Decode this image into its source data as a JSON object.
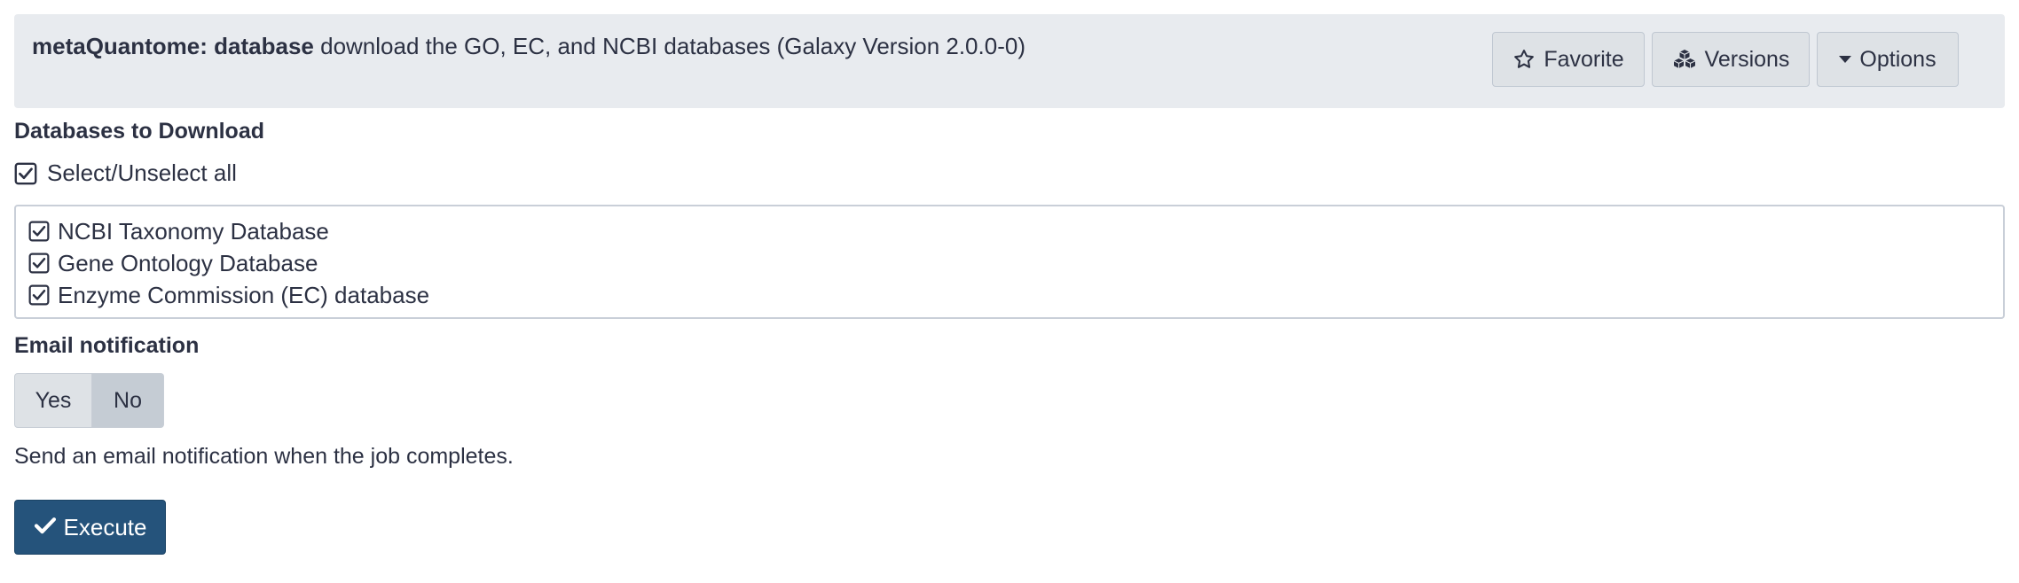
{
  "header": {
    "tool_name": "metaQuantome: database",
    "description": "download the GO, EC, and NCBI databases (Galaxy Version 2.0.0-0)",
    "favorite_label": "Favorite",
    "versions_label": "Versions",
    "options_label": "Options"
  },
  "databases": {
    "label": "Databases to Download",
    "select_all_label": "Select/Unselect all",
    "select_all_checked": true,
    "options": [
      {
        "label": "NCBI Taxonomy Database",
        "checked": true
      },
      {
        "label": "Gene Ontology Database",
        "checked": true
      },
      {
        "label": "Enzyme Commission (EC) database",
        "checked": true
      }
    ]
  },
  "email": {
    "label": "Email notification",
    "yes_label": "Yes",
    "no_label": "No",
    "selected": "No",
    "help": "Send an email notification when the job completes."
  },
  "execute": {
    "label": "Execute"
  },
  "icons": {
    "favorite": "star-outline-icon",
    "versions": "cubes-icon",
    "options": "caret-down-icon",
    "checkbox": "checkbox-checked-icon",
    "execute": "check-icon"
  },
  "colors": {
    "header_bg": "#e8ebef",
    "button_bg": "#dee2e6",
    "toggle_selected_bg": "#c5ccd4",
    "primary": "#25537b",
    "text": "#2c3143"
  }
}
